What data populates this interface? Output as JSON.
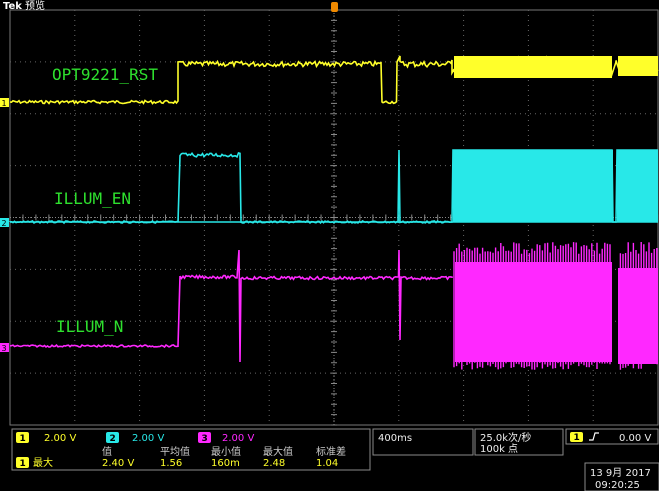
{
  "header": {
    "brand": "Tek",
    "mode": "预览"
  },
  "colors": {
    "ch1": "#ffff2a",
    "ch2": "#28e8e8",
    "ch3": "#ff28ff",
    "label": "#2ee02e",
    "grid": "#666666"
  },
  "trace_labels": {
    "ch1": "OPT9221_RST",
    "ch2": "ILLUM_EN",
    "ch3": "ILLUM_N"
  },
  "channel_markers": {
    "ch1": "1",
    "ch2": "2",
    "ch3": "3"
  },
  "status": {
    "ch1": {
      "num": "1",
      "scale": "2.00 V"
    },
    "ch2": {
      "num": "2",
      "scale": "2.00 V"
    },
    "ch3": {
      "num": "3",
      "scale": "2.00 V"
    },
    "timebase": "400ms",
    "sample_rate": "25.0k次/秒",
    "record_length": "100k 点",
    "trigger": {
      "channel": "1",
      "slope": "∫",
      "level": "0.00 V"
    },
    "measurement": {
      "channel": "1",
      "label": "最大",
      "headers": [
        "值",
        "平均值",
        "最小值",
        "最大值",
        "标准差"
      ],
      "values": [
        "2.40 V",
        "1.56",
        "160m",
        "2.48",
        "1.04"
      ]
    },
    "date": "13 9月  2017",
    "time": "09:20:25"
  }
}
